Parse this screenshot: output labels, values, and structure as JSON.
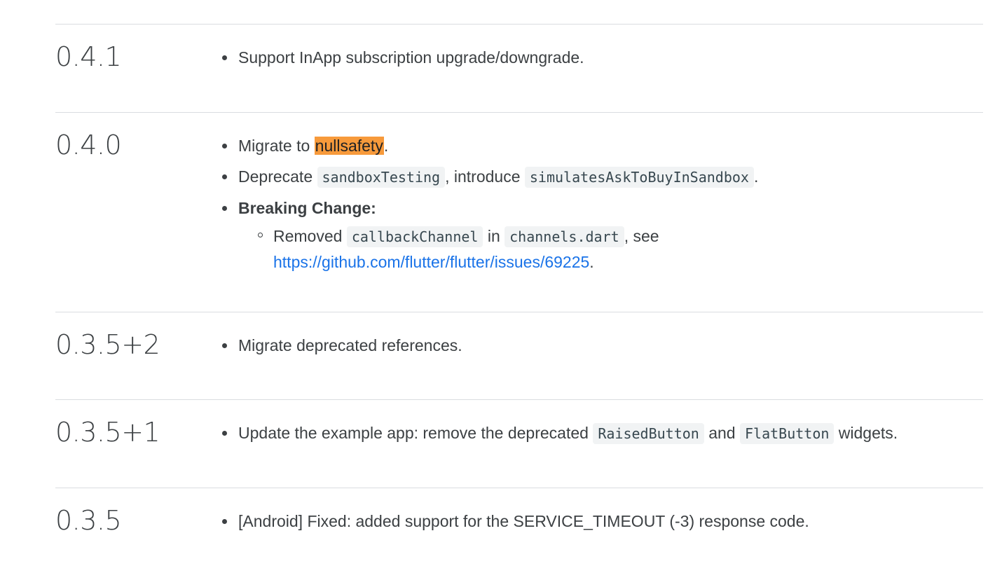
{
  "entries": [
    {
      "version": "0.4.1",
      "note1": "Support InApp subscription upgrade/downgrade."
    },
    {
      "version": "0.4.0",
      "migrate_prefix": "Migrate to ",
      "migrate_highlight": "nullsafety",
      "migrate_suffix": ".",
      "deprecate_prefix": "Deprecate ",
      "deprecate_code1": "sandboxTesting",
      "deprecate_mid": ", introduce ",
      "deprecate_code2": "simulatesAskToBuyInSandbox",
      "deprecate_suffix": ".",
      "breaking_label": "Breaking Change:",
      "removed_prefix": "Removed ",
      "removed_code1": "callbackChannel",
      "removed_mid": " in ",
      "removed_code2": "channels.dart",
      "removed_suffix": ", see",
      "issue_link": "https://github.com/flutter/flutter/issues/69225",
      "issue_suffix": "."
    },
    {
      "version": "0.3.5+2",
      "note1": "Migrate deprecated references."
    },
    {
      "version": "0.3.5+1",
      "update_prefix": "Update the example app: remove the deprecated ",
      "update_code1": "RaisedButton",
      "update_mid": " and ",
      "update_code2": "FlatButton",
      "update_suffix": " widgets."
    },
    {
      "version": "0.3.5",
      "note1": "[Android] Fixed: added support for the SERVICE_TIMEOUT (-3) response code."
    }
  ],
  "colors": {
    "text": "#3c4043",
    "divider": "#dadce0",
    "highlight": "#f79a3b",
    "link": "#1a73e8",
    "code_bg": "#f1f3f4"
  }
}
